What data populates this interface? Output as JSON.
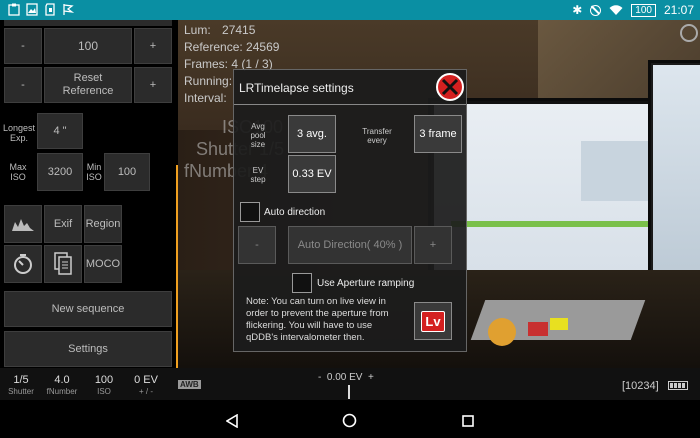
{
  "status_bar": {
    "battery": "100",
    "time": "21:07"
  },
  "info": {
    "lum_label": "Lum:",
    "lum_value": "27415",
    "reference_label": "Reference:",
    "reference_value": "24569",
    "frames_label": "Frames:",
    "frames_value": "4 (1 / 3)",
    "running_label": "Running:",
    "interval_label": "Interval:"
  },
  "overlay": {
    "iso": "ISO100",
    "shutter": "Shutter 1/5",
    "fnumber": "fNumber 4"
  },
  "left_panel": {
    "minus": "-",
    "plus": "+",
    "step_value": "100",
    "reset_reference": "Reset Reference",
    "longest_exp_label": "Longest Exp.",
    "longest_exp_value": "4 \"",
    "max_iso_label": "Max ISO",
    "max_iso_value": "3200",
    "min_iso_label": "Min ISO",
    "min_iso_value": "100",
    "exif": "Exif",
    "region": "Region",
    "moco": "MOCO",
    "new_sequence": "New sequence",
    "settings": "Settings"
  },
  "dialog": {
    "title": "LRTimelapse settings",
    "avg_label": "Avg pool size",
    "avg_value": "3 avg.",
    "transfer_label": "Transfer every",
    "transfer_value": "3 frame",
    "ev_step_label": "EV step",
    "ev_step_value": "0.33 EV",
    "auto_direction_label": "Auto direction",
    "auto_direction_minus": "-",
    "auto_direction_value": "Auto Direction( 40% )",
    "auto_direction_plus": "+",
    "aperture_ramping_label": "Use Aperture ramping",
    "note": "Note: You can turn on live view in order to prevent the aperture from flickering.  You will have to use qDDB's intervalometer then.",
    "lv_label": "Lv"
  },
  "bottom_bar": {
    "shutter_value": "1/5",
    "shutter_label": "Shutter",
    "fnumber_value": "4.0",
    "fnumber_label": "fNumber",
    "iso_value": "100",
    "iso_label": "ISO",
    "ev_value": "0 EV",
    "ev_label": "+ / -",
    "awb": "AWB",
    "ev_scale": "-  0.00 EV  +",
    "remaining": "[10234]"
  },
  "colors": {
    "statusbar": "#0a8fa3",
    "accent": "#f0a020",
    "close_red": "#d42020"
  }
}
